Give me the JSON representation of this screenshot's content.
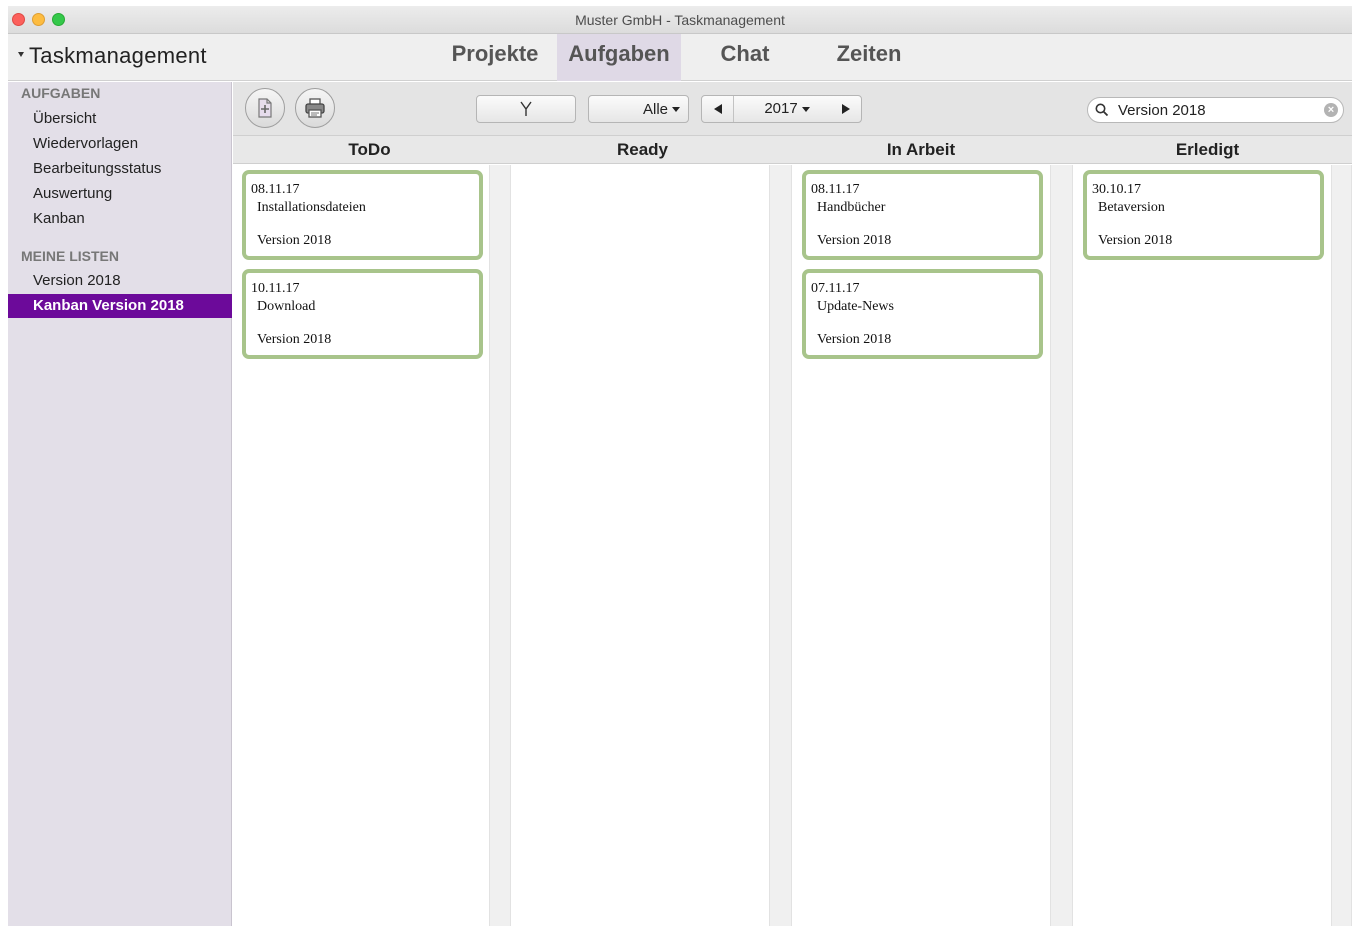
{
  "window": {
    "title": "Muster GmbH - Taskmanagement"
  },
  "header": {
    "app_title": "Taskmanagement",
    "nav": [
      {
        "label": "Projekte",
        "active": false
      },
      {
        "label": "Aufgaben",
        "active": true
      },
      {
        "label": "Chat",
        "active": false
      },
      {
        "label": "Zeiten",
        "active": false
      }
    ]
  },
  "sidebar": {
    "sections": [
      {
        "heading": "AUFGABEN",
        "items": [
          {
            "label": "Übersicht"
          },
          {
            "label": "Wiedervorlagen"
          },
          {
            "label": "Bearbeitungsstatus"
          },
          {
            "label": "Auswertung"
          },
          {
            "label": "Kanban"
          }
        ]
      },
      {
        "heading": "MEINE LISTEN",
        "items": [
          {
            "label": "Version 2018"
          },
          {
            "label": "Kanban Version 2018",
            "selected": true
          }
        ]
      }
    ]
  },
  "toolbar": {
    "new_icon": "new-document-icon",
    "print_icon": "printer-icon",
    "filter_icon": "filter-funnel-icon",
    "scope_label": "Alle",
    "year_label": "2017",
    "search": {
      "value": "Version 2018",
      "placeholder": ""
    }
  },
  "board": {
    "columns": [
      {
        "name": "ToDo",
        "cards": [
          {
            "date": "08.11.17",
            "title": "Installationsdateien",
            "version": "Version 2018"
          },
          {
            "date": "10.11.17",
            "title": "Download",
            "version": "Version 2018"
          }
        ]
      },
      {
        "name": "Ready",
        "cards": []
      },
      {
        "name": "In Arbeit",
        "cards": [
          {
            "date": "08.11.17",
            "title": "Handbücher",
            "version": "Version 2018"
          },
          {
            "date": "07.11.17",
            "title": "Update-News",
            "version": "Version 2018"
          }
        ]
      },
      {
        "name": "Erledigt",
        "cards": [
          {
            "date": "30.10.17",
            "title": "Betaversion",
            "version": "Version 2018"
          }
        ]
      }
    ]
  },
  "colors": {
    "sidebar_bg": "#e3dfe8",
    "sidebar_selected": "#6c0a9a",
    "card_border": "#a8c48b",
    "nav_active_bg": "#dfd9e6"
  }
}
